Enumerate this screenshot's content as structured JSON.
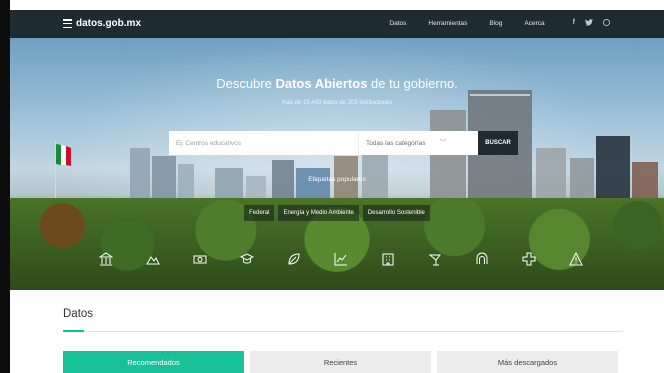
{
  "nav": {
    "logo_text": "datos.gob.mx",
    "links": [
      "Datos",
      "Herramientas",
      "Blog",
      "Acerca"
    ],
    "social": [
      "f",
      "t",
      "o"
    ]
  },
  "hero": {
    "title_prefix": "Descubre ",
    "title_bold": "Datos Abiertos",
    "title_suffix": " de tu gobierno.",
    "subtitle": "más de 15,400 datos de 209 instituciones",
    "search": {
      "placeholder": "Ej. Centros educativos",
      "category": "Todas las categorías",
      "button": "BUSCAR"
    },
    "popular_label": "Etiquetas populares",
    "tags": [
      "Federal",
      "Energía y Medio Ambiente",
      "Desarrollo Sostenible"
    ],
    "categories": [
      "government-icon",
      "mountain-icon",
      "money-icon",
      "graduation-icon",
      "leaf-icon",
      "chart-icon",
      "building-icon",
      "tree-icon",
      "transit-icon",
      "health-icon",
      "warning-icon"
    ]
  },
  "datos": {
    "title": "Datos",
    "tabs": [
      "Recomendados",
      "Recientes",
      "Más descargados"
    ],
    "accent_color": "#19c198"
  }
}
